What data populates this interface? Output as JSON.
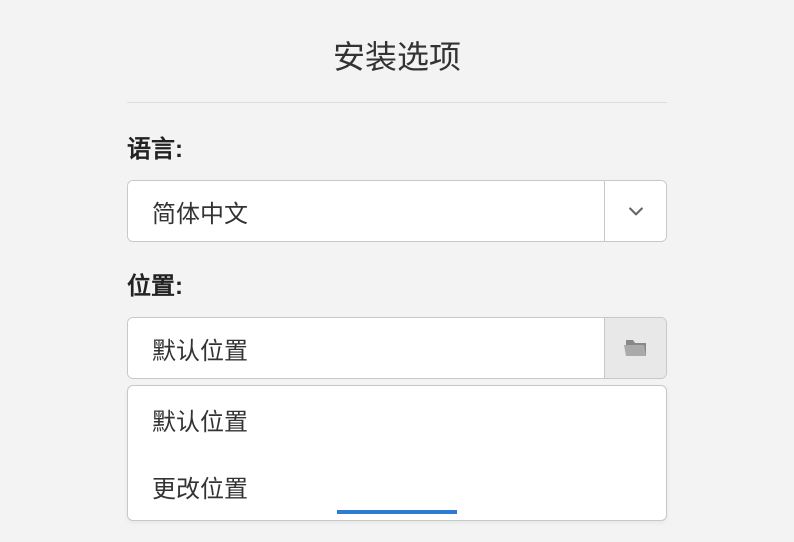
{
  "title": "安装选项",
  "language": {
    "label": "语言:",
    "value": "简体中文"
  },
  "location": {
    "label": "位置:",
    "value": "默认位置",
    "options": [
      "默认位置",
      "更改位置"
    ]
  }
}
